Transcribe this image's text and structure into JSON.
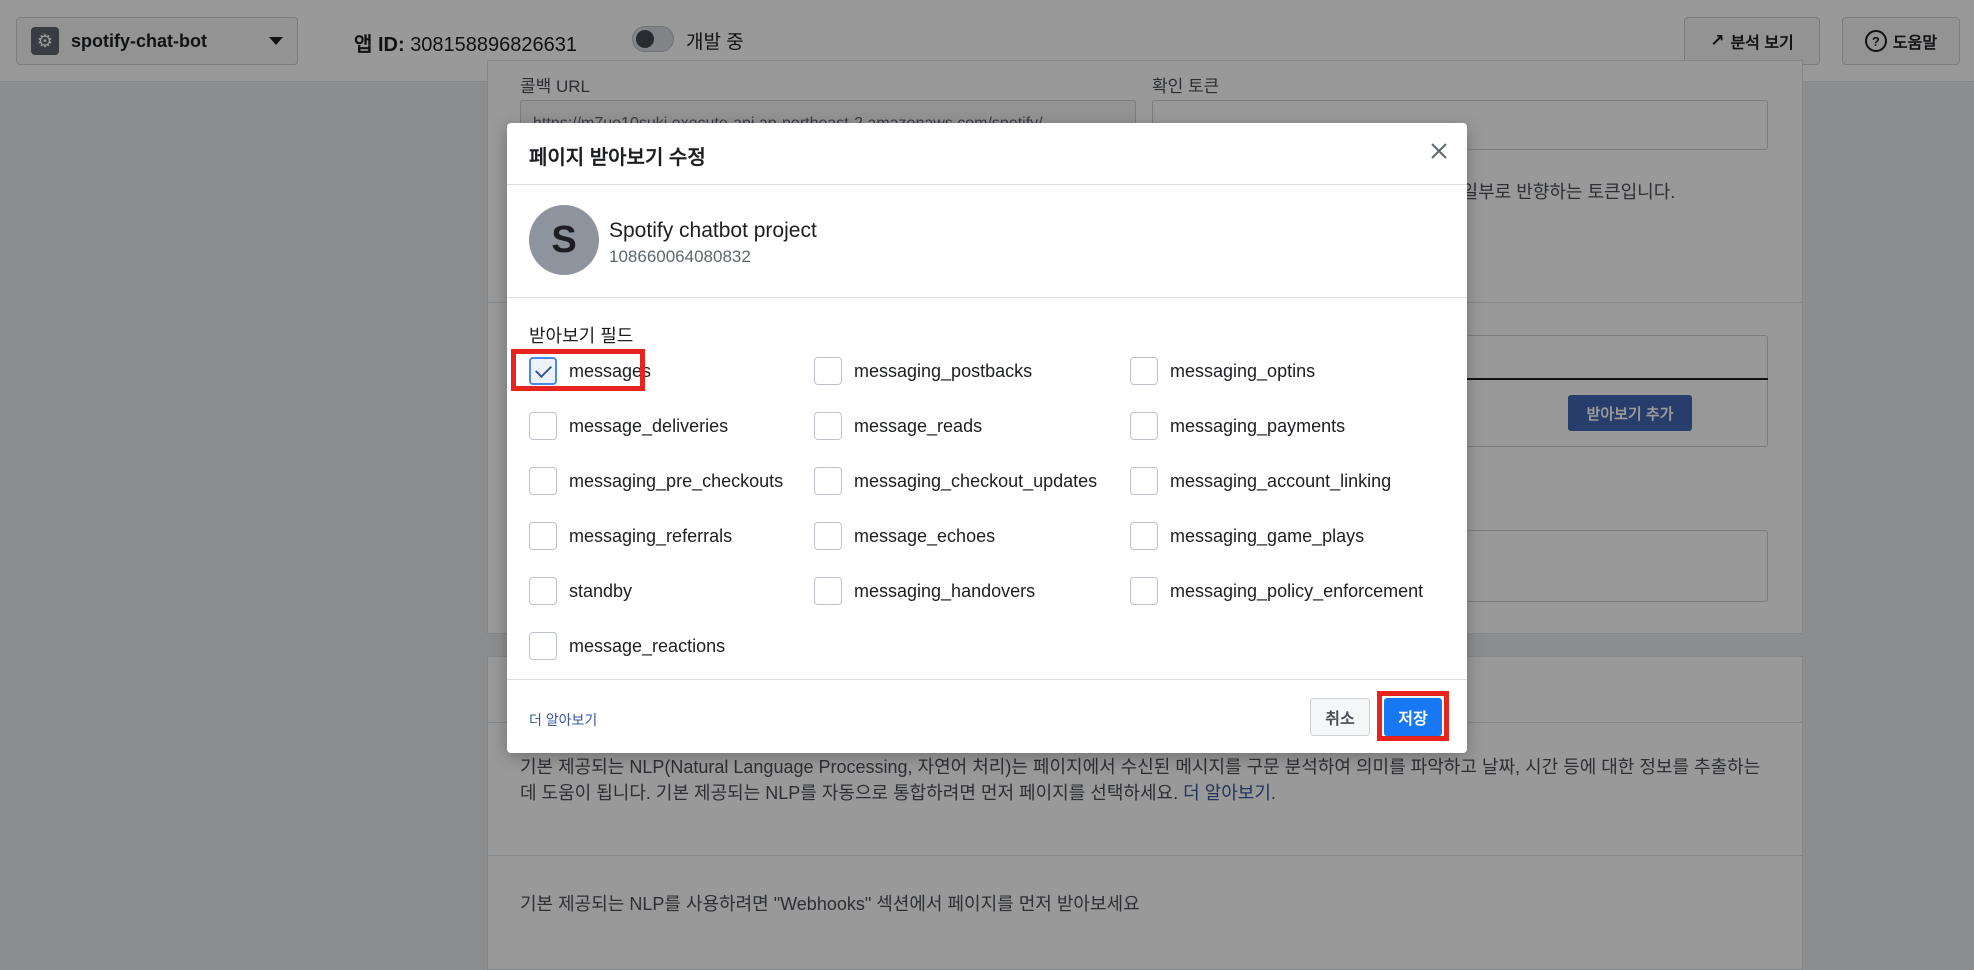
{
  "topbar": {
    "app_name": "spotify-chat-bot",
    "app_id_label": "앱 ID:",
    "app_id_value": "308158896826631",
    "dev_status": "개발 중",
    "analytics_label": "분석 보기",
    "help_label": "도움말"
  },
  "background": {
    "callback_url_label": "콜백 URL",
    "verify_token_label": "확인 토큰",
    "callback_url_value": "https://m7ue10sukj.execute-api.ap-northeast-2.amazonaws.com/spotify/",
    "token_hint": "의 일부로 반향하는 토큰입니다.",
    "add_subscription_label": "받아보기 추가",
    "nlp_description": "기본 제공되는 NLP(Natural Language Processing, 자연어 처리)는 페이지에서 수신된 메시지를 구문 분석하여 의미를 파악하고 날짜, 시간 등에 대한 정보를 추출하는 데 도움이 됩니다. 기본 제공되는 NLP를 자동으로 통합하려면 먼저 페이지를 선택하세요.",
    "nlp_learn_more": "더 알아보기",
    "nlp_note": "기본 제공되는 NLP를 사용하려면 \"Webhooks\" 섹션에서 페이지를 먼저 받아보세요"
  },
  "modal": {
    "title": "페이지 받아보기 수정",
    "page": {
      "avatar_letter": "S",
      "name": "Spotify chatbot project",
      "id": "108660064080832"
    },
    "fields_label": "받아보기 필드",
    "fields": [
      {
        "label": "messages",
        "checked": true
      },
      {
        "label": "messaging_postbacks",
        "checked": false
      },
      {
        "label": "messaging_optins",
        "checked": false
      },
      {
        "label": "message_deliveries",
        "checked": false
      },
      {
        "label": "message_reads",
        "checked": false
      },
      {
        "label": "messaging_payments",
        "checked": false
      },
      {
        "label": "messaging_pre_checkouts",
        "checked": false
      },
      {
        "label": "messaging_checkout_updates",
        "checked": false
      },
      {
        "label": "messaging_account_linking",
        "checked": false
      },
      {
        "label": "messaging_referrals",
        "checked": false
      },
      {
        "label": "message_echoes",
        "checked": false
      },
      {
        "label": "messaging_game_plays",
        "checked": false
      },
      {
        "label": "standby",
        "checked": false
      },
      {
        "label": "messaging_handovers",
        "checked": false
      },
      {
        "label": "messaging_policy_enforcement",
        "checked": false
      },
      {
        "label": "message_reactions",
        "checked": false
      }
    ],
    "learn_more": "더 알아보기",
    "cancel_label": "취소",
    "save_label": "저장"
  },
  "colors": {
    "primary": "#1877f2",
    "highlight": "#e8241f",
    "link": "#385898"
  },
  "icons": [
    "gear-icon",
    "chevron-down-icon",
    "trending-up-icon",
    "help-icon",
    "close-icon",
    "checkmark-icon"
  ]
}
